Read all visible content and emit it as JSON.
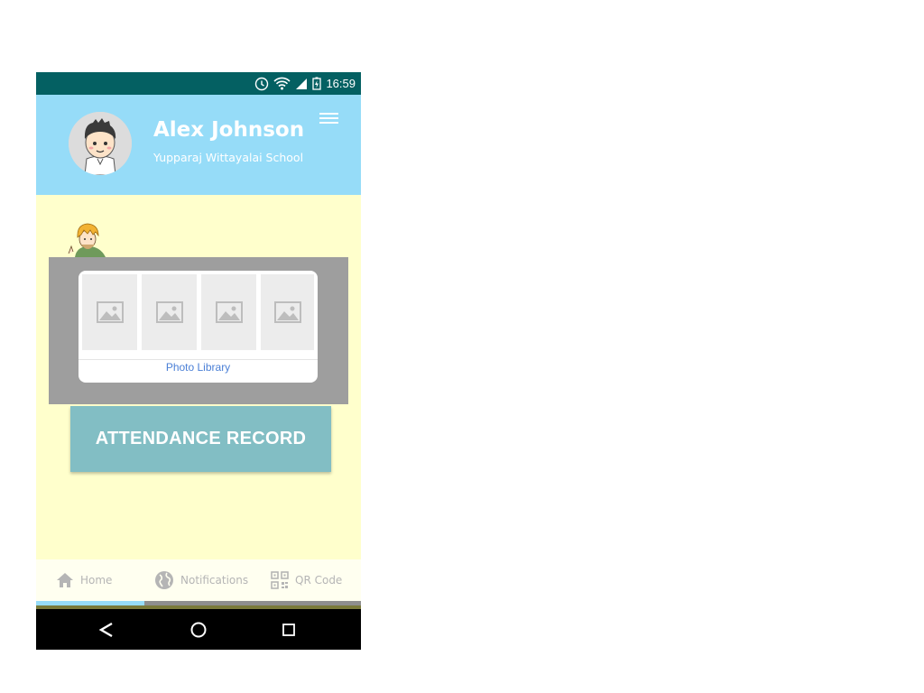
{
  "status_bar": {
    "time": "16:59",
    "icons": [
      "alarm-icon",
      "wifi-icon",
      "signal-icon",
      "battery-icon"
    ]
  },
  "header": {
    "user_name": "Alex Johnson",
    "school_name": "Yupparaj Wittayalai School",
    "background_color": "#96dcf8",
    "menu_icon": "hamburger-menu-icon"
  },
  "photo_picker": {
    "label": "Photo Library",
    "thumbnails": [
      "image-placeholder-icon",
      "image-placeholder-icon",
      "image-placeholder-icon",
      "image-placeholder-icon"
    ]
  },
  "attendance_button": {
    "label": "ATTENDANCE RECORD",
    "color": "#82bec4"
  },
  "tabs": [
    {
      "label": "Home",
      "icon": "home-icon",
      "active": true
    },
    {
      "label": "Notifications",
      "icon": "globe-icon",
      "active": false
    },
    {
      "label": "QR Code",
      "icon": "qr-code-icon",
      "active": false
    }
  ],
  "nav_bar": {
    "buttons": [
      "back-icon",
      "home-circle-icon",
      "recents-icon"
    ]
  },
  "colors": {
    "status_bar": "#046062",
    "content_background": "#ffffcc",
    "tab_indicator": "#96dcf8"
  }
}
